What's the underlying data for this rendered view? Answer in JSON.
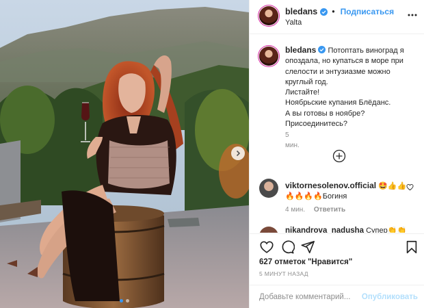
{
  "post": {
    "username": "bledans",
    "follow_label": "Подписаться",
    "bullet": "•",
    "location": "Yalta",
    "more_icon": "more-horizontal-icon",
    "verified_icon": "verified-badge-icon",
    "caption_lines": [
      "Потоптать виноград я",
      "опоздала, но купаться в море при",
      "слелости и энтузиазме можно",
      "круглый год.",
      "Листайте!",
      "Ноябрьские купания Блёданс.",
      "А вы готовы в ноябре?",
      "Присоединитесь?"
    ],
    "caption_time": "5 мин.",
    "load_more_icon": "plus-circle-icon",
    "comments": [
      {
        "username": "viktornesolenov.official",
        "text_line1": "🤩👍👍",
        "text_line2": "🔥🔥🔥🔥Богиня",
        "time": "4 мин.",
        "reply_label": "Ответить"
      },
      {
        "username": "nikandrova_nadusha",
        "text": "Супер👏👏"
      }
    ],
    "likes": "627 отметок \"Нравится\"",
    "posted_ago": "5 МИНУТ НАЗАД",
    "comment_placeholder": "Добавьте комментарий...",
    "post_label": "Опубликовать",
    "actions": [
      "heart-icon",
      "comment-icon",
      "share-icon",
      "bookmark-icon"
    ],
    "carousel": {
      "current": 1,
      "total": 2
    },
    "colors": {
      "link": "#3897f0",
      "muted": "#8e8e8e",
      "post_disabled": "#b2dffc",
      "text": "#262626"
    }
  }
}
